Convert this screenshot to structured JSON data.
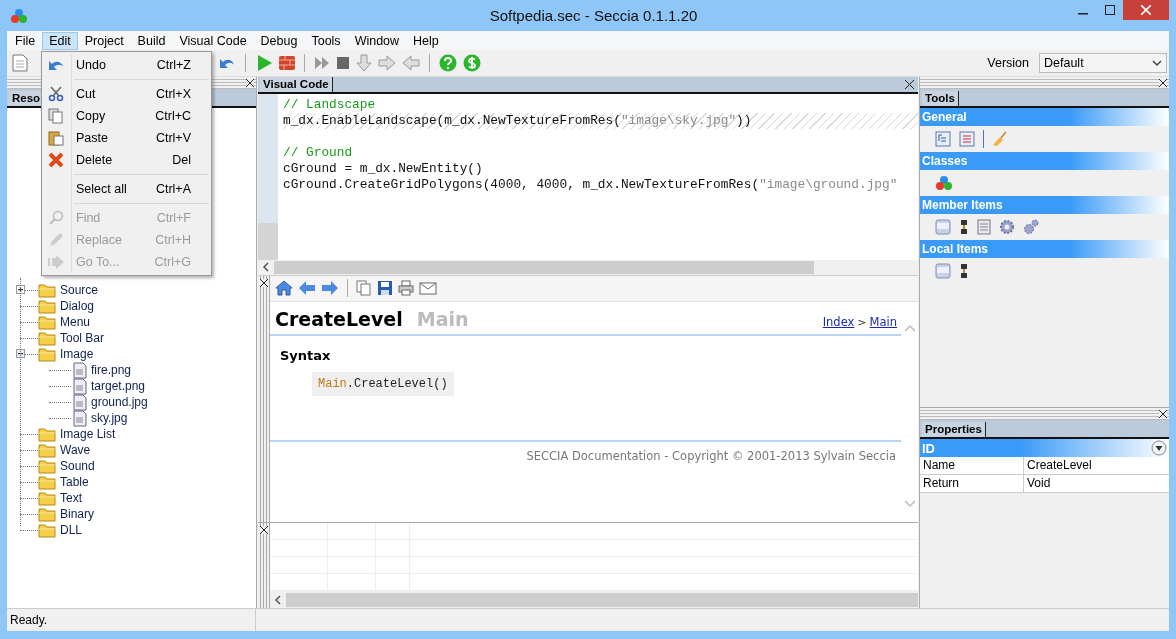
{
  "window": {
    "title": "Softpedia.sec - Seccia 0.1.1.20"
  },
  "menu_bar": [
    {
      "label": "File",
      "selected": false
    },
    {
      "label": "Edit",
      "selected": true
    },
    {
      "label": "Project",
      "selected": false
    },
    {
      "label": "Build",
      "selected": false
    },
    {
      "label": "Visual Code",
      "selected": false
    },
    {
      "label": "Debug",
      "selected": false
    },
    {
      "label": "Tools",
      "selected": false
    },
    {
      "label": "Window",
      "selected": false
    },
    {
      "label": "Help",
      "selected": false
    }
  ],
  "edit_menu": [
    {
      "kind": "item",
      "label": "Undo",
      "shortcut": "Ctrl+Z",
      "disabled": false
    },
    {
      "kind": "separator"
    },
    {
      "kind": "item",
      "label": "Cut",
      "shortcut": "Ctrl+X",
      "disabled": false
    },
    {
      "kind": "item",
      "label": "Copy",
      "shortcut": "Ctrl+C",
      "disabled": false
    },
    {
      "kind": "item",
      "label": "Paste",
      "shortcut": "Ctrl+V",
      "disabled": false
    },
    {
      "kind": "item",
      "label": "Delete",
      "shortcut": "Del",
      "disabled": false
    },
    {
      "kind": "separator"
    },
    {
      "kind": "item",
      "label": "Select all",
      "shortcut": "Ctrl+A",
      "disabled": false
    },
    {
      "kind": "separator"
    },
    {
      "kind": "item",
      "label": "Find",
      "shortcut": "Ctrl+F",
      "disabled": true
    },
    {
      "kind": "item",
      "label": "Replace",
      "shortcut": "Ctrl+H",
      "disabled": true
    },
    {
      "kind": "item",
      "label": "Go To...",
      "shortcut": "Ctrl+G",
      "disabled": true
    }
  ],
  "toolbar": {
    "version_label": "Version",
    "version_value": "Default"
  },
  "resources_panel": {
    "tab": "Reso",
    "tree": [
      {
        "label": "Source",
        "expanded": false
      },
      {
        "label": "Dialog"
      },
      {
        "label": "Menu"
      },
      {
        "label": "Tool Bar"
      },
      {
        "label": "Image",
        "expanded": true,
        "children": [
          {
            "label": "fire.png"
          },
          {
            "label": "target.png"
          },
          {
            "label": "ground.jpg"
          },
          {
            "label": "sky.jpg"
          }
        ]
      },
      {
        "label": "Image List"
      },
      {
        "label": "Wave"
      },
      {
        "label": "Sound"
      },
      {
        "label": "Table"
      },
      {
        "label": "Text"
      },
      {
        "label": "Binary"
      },
      {
        "label": "DLL"
      }
    ]
  },
  "editor": {
    "tab": "Visual Code",
    "lines": [
      {
        "kind": "code",
        "highlighted": false,
        "tokens": [
          {
            "kind": "comment",
            "text": "// Landscape"
          }
        ]
      },
      {
        "kind": "code",
        "highlighted": true,
        "tokens": [
          {
            "kind": "plain",
            "text": "m_dx.EnableLandscape(m_dx.NewTextureFromRes("
          },
          {
            "kind": "string",
            "text": "\"image\\sky.jpg\""
          },
          {
            "kind": "plain",
            "text": "))"
          }
        ]
      },
      {
        "kind": "blank",
        "highlighted": false
      },
      {
        "kind": "code",
        "highlighted": false,
        "tokens": [
          {
            "kind": "comment",
            "text": "// Ground"
          }
        ]
      },
      {
        "kind": "code",
        "highlighted": false,
        "tokens": [
          {
            "kind": "plain",
            "text": "cGround = m_dx.NewEntity()"
          }
        ]
      },
      {
        "kind": "code",
        "highlighted": false,
        "tokens": [
          {
            "kind": "plain",
            "text": "cGround.CreateGridPolygons(4000, 4000, m_dx.NewTextureFromRes("
          },
          {
            "kind": "string",
            "text": "\"image\\ground.jpg\""
          }
        ]
      }
    ]
  },
  "help": {
    "title": "CreateLevel",
    "subtitle": "Main",
    "breadcrumb": [
      {
        "kind": "link",
        "text": "Index"
      },
      {
        "kind": "sep",
        "text": ">"
      },
      {
        "kind": "link",
        "text": "Main"
      }
    ],
    "heading": "Syntax",
    "syntax": [
      {
        "kind": "class",
        "text": "Main"
      },
      {
        "kind": "plain",
        "text": ".CreateLevel()"
      }
    ],
    "footer": "SECCIA Documentation - Copyright © 2001-2013 Sylvain Seccia"
  },
  "tools_panel": {
    "tab": "Tools",
    "sections": [
      {
        "title": "General"
      },
      {
        "title": "Classes"
      },
      {
        "title": "Member Items"
      },
      {
        "title": "Local Items"
      }
    ]
  },
  "properties_panel": {
    "tab": "Properties",
    "group": "ID",
    "rows": [
      {
        "name": "Name",
        "value": "CreateLevel"
      },
      {
        "name": "Return",
        "value": "Void"
      }
    ]
  },
  "status_bar": {
    "text": "Ready."
  }
}
